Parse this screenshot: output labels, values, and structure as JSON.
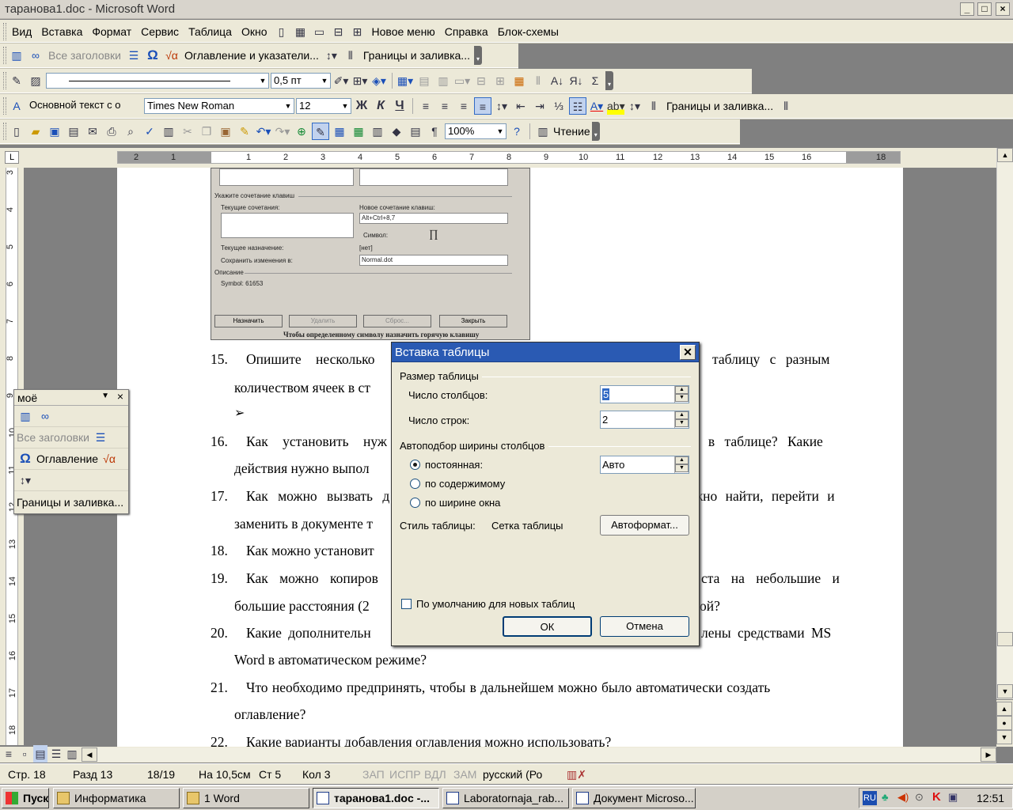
{
  "window": {
    "title": "таранова1.doc - Microsoft Word",
    "min": "_",
    "max": "□",
    "close": "×"
  },
  "menu": {
    "items": [
      "Вид",
      "Вставка",
      "Формат",
      "Сервис",
      "Таблица",
      "Окно",
      "Новое меню",
      "Справка",
      "Блок-схемы"
    ]
  },
  "toolbar_outline": {
    "all_headings": "Все заголовки",
    "toc_label": "Оглавление и указатели...",
    "borders_label": "Границы и заливка..."
  },
  "toolbar_drawing": {
    "line_weight": "0,5 пт"
  },
  "toolbar_format": {
    "style": "Основной текст с о",
    "font": "Times New Roman",
    "size": "12",
    "bold": "Ж",
    "italic": "К",
    "underline": "Ч",
    "borders_label": "Границы и заливка..."
  },
  "toolbar_standard": {
    "zoom": "100%",
    "reading": "Чтение",
    "pilcrow": "¶"
  },
  "ruler": {
    "h_ticks": [
      "2",
      "1",
      "1",
      "2",
      "3",
      "4",
      "5",
      "6",
      "7",
      "8",
      "9",
      "10",
      "11",
      "12",
      "13",
      "14",
      "15",
      "16",
      "18"
    ],
    "v_ticks": [
      "3",
      "4",
      "5",
      "6",
      "7",
      "8",
      "9",
      "10",
      "11",
      "12",
      "13",
      "14",
      "15",
      "16",
      "17",
      "18"
    ]
  },
  "floatbar": {
    "title": "моё",
    "all_headings": "Все заголовки",
    "toc": "Оглавление",
    "borders": "Границы и заливка..."
  },
  "screenshot_dialog": {
    "shortcut_header": "Укажите сочетание клавиш",
    "current_keys": "Текущие сочетания:",
    "new_keys": "Новое сочетание клавиш:",
    "new_keys_value": "Alt+Ctrl+8,7",
    "symbol_label": "Символ:",
    "symbol": "∏",
    "assigned_label": "Текущее назначение:",
    "assigned_value": "[нет]",
    "save_in_label": "Сохранить изменения в:",
    "save_in_value": "Normal.dot",
    "desc_label": "Описание",
    "desc_value": "Symbol: 61653",
    "btn_assign": "Назначить",
    "btn_delete": "Удалить",
    "btn_reset": "Сброс...",
    "btn_close": "Закрыть",
    "caption": "Чтобы определенному символу назначить горячую клавишу"
  },
  "document": {
    "items": [
      {
        "num": "15.",
        "line1": "Опишите несколько",
        "line1_right": "таблицу с разным",
        "line2": "количеством ячеек в ст"
      },
      {
        "num": "16.",
        "line1": "Как установить нуж",
        "line1_right": "к в таблице? Какие",
        "line2": "действия нужно выпол"
      },
      {
        "num": "17.",
        "line1": "Как можно вызвать д",
        "line1_right": "жно найти, перейти и",
        "line2": "заменить в документе т"
      },
      {
        "num": "18.",
        "line1": "Как можно установит",
        "line1_right": "",
        "line2": ""
      },
      {
        "num": "19.",
        "line1": "Как можно копиров",
        "line1_right": "ста на небольшие и",
        "line2": "большие расстояния (2",
        "line2_right": "ой?"
      },
      {
        "num": "20.",
        "line1": "Какие дополнительн",
        "line1_right": "лены средствами MS",
        "line2": "Word в автоматическом режиме?"
      },
      {
        "num": "21.",
        "line1": "Что необходимо предпринять, чтобы в дальнейшем можно было автоматически создать",
        "line1_right": "",
        "line2": "оглавление?"
      },
      {
        "num": "22.",
        "line1": "Какие варианты добавления оглавления можно использовать?",
        "line1_right": "",
        "line2": ""
      }
    ],
    "arrow": "➢"
  },
  "dialog": {
    "title": "Вставка таблицы",
    "size_group": "Размер таблицы",
    "cols_label": "Число столбцов:",
    "cols_value": "5",
    "rows_label": "Число строк:",
    "rows_value": "2",
    "autofit_group": "Автоподбор ширины столбцов",
    "fixed_label": "постоянная:",
    "fixed_value": "Авто",
    "content_label": "по содержимому",
    "window_label": "по ширине окна",
    "style_label": "Стиль таблицы:",
    "style_value": "Сетка таблицы",
    "autoformat_btn": "Автоформат...",
    "default_check": "По умолчанию для новых таблиц",
    "ok_btn": "ОК",
    "cancel_btn": "Отмена",
    "selected_autofit": "fixed"
  },
  "status": {
    "page": "Стр. 18",
    "section": "Разд 13",
    "pages": "18/19",
    "at": "На 10,5см",
    "line": "Ст 5",
    "col": "Кол 3",
    "rec": "ЗАП",
    "trk": "ИСПР",
    "ext": "ВДЛ",
    "ovr": "ЗАМ",
    "lang": "русский (Ро"
  },
  "taskbar": {
    "start": "Пуск",
    "buttons": [
      "Информатика",
      "1 Word",
      "таранова1.doc -...",
      "Laboratornaja_rab...",
      "Документ Microso..."
    ],
    "lang": "RU",
    "clock": "12:51"
  }
}
